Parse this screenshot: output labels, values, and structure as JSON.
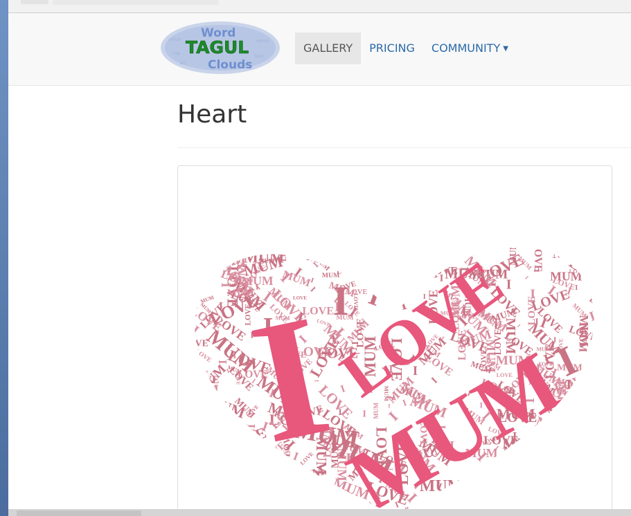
{
  "logo": {
    "line1": "Word",
    "line2": "TAGUL",
    "line3": "Clouds"
  },
  "nav": {
    "items": [
      {
        "label": "GALLERY",
        "active": true
      },
      {
        "label": "PRICING",
        "active": false
      },
      {
        "label": "COMMUNITY",
        "active": false,
        "dropdown": true
      }
    ]
  },
  "page": {
    "title": "Heart"
  },
  "cloud": {
    "words": [
      "I",
      "LOVE",
      "MUM"
    ],
    "colors": {
      "primary": "#e8577c",
      "secondary": "#c97384",
      "light": "#d98fa0"
    }
  },
  "icons": {
    "dropdown": "caret-down-icon"
  }
}
